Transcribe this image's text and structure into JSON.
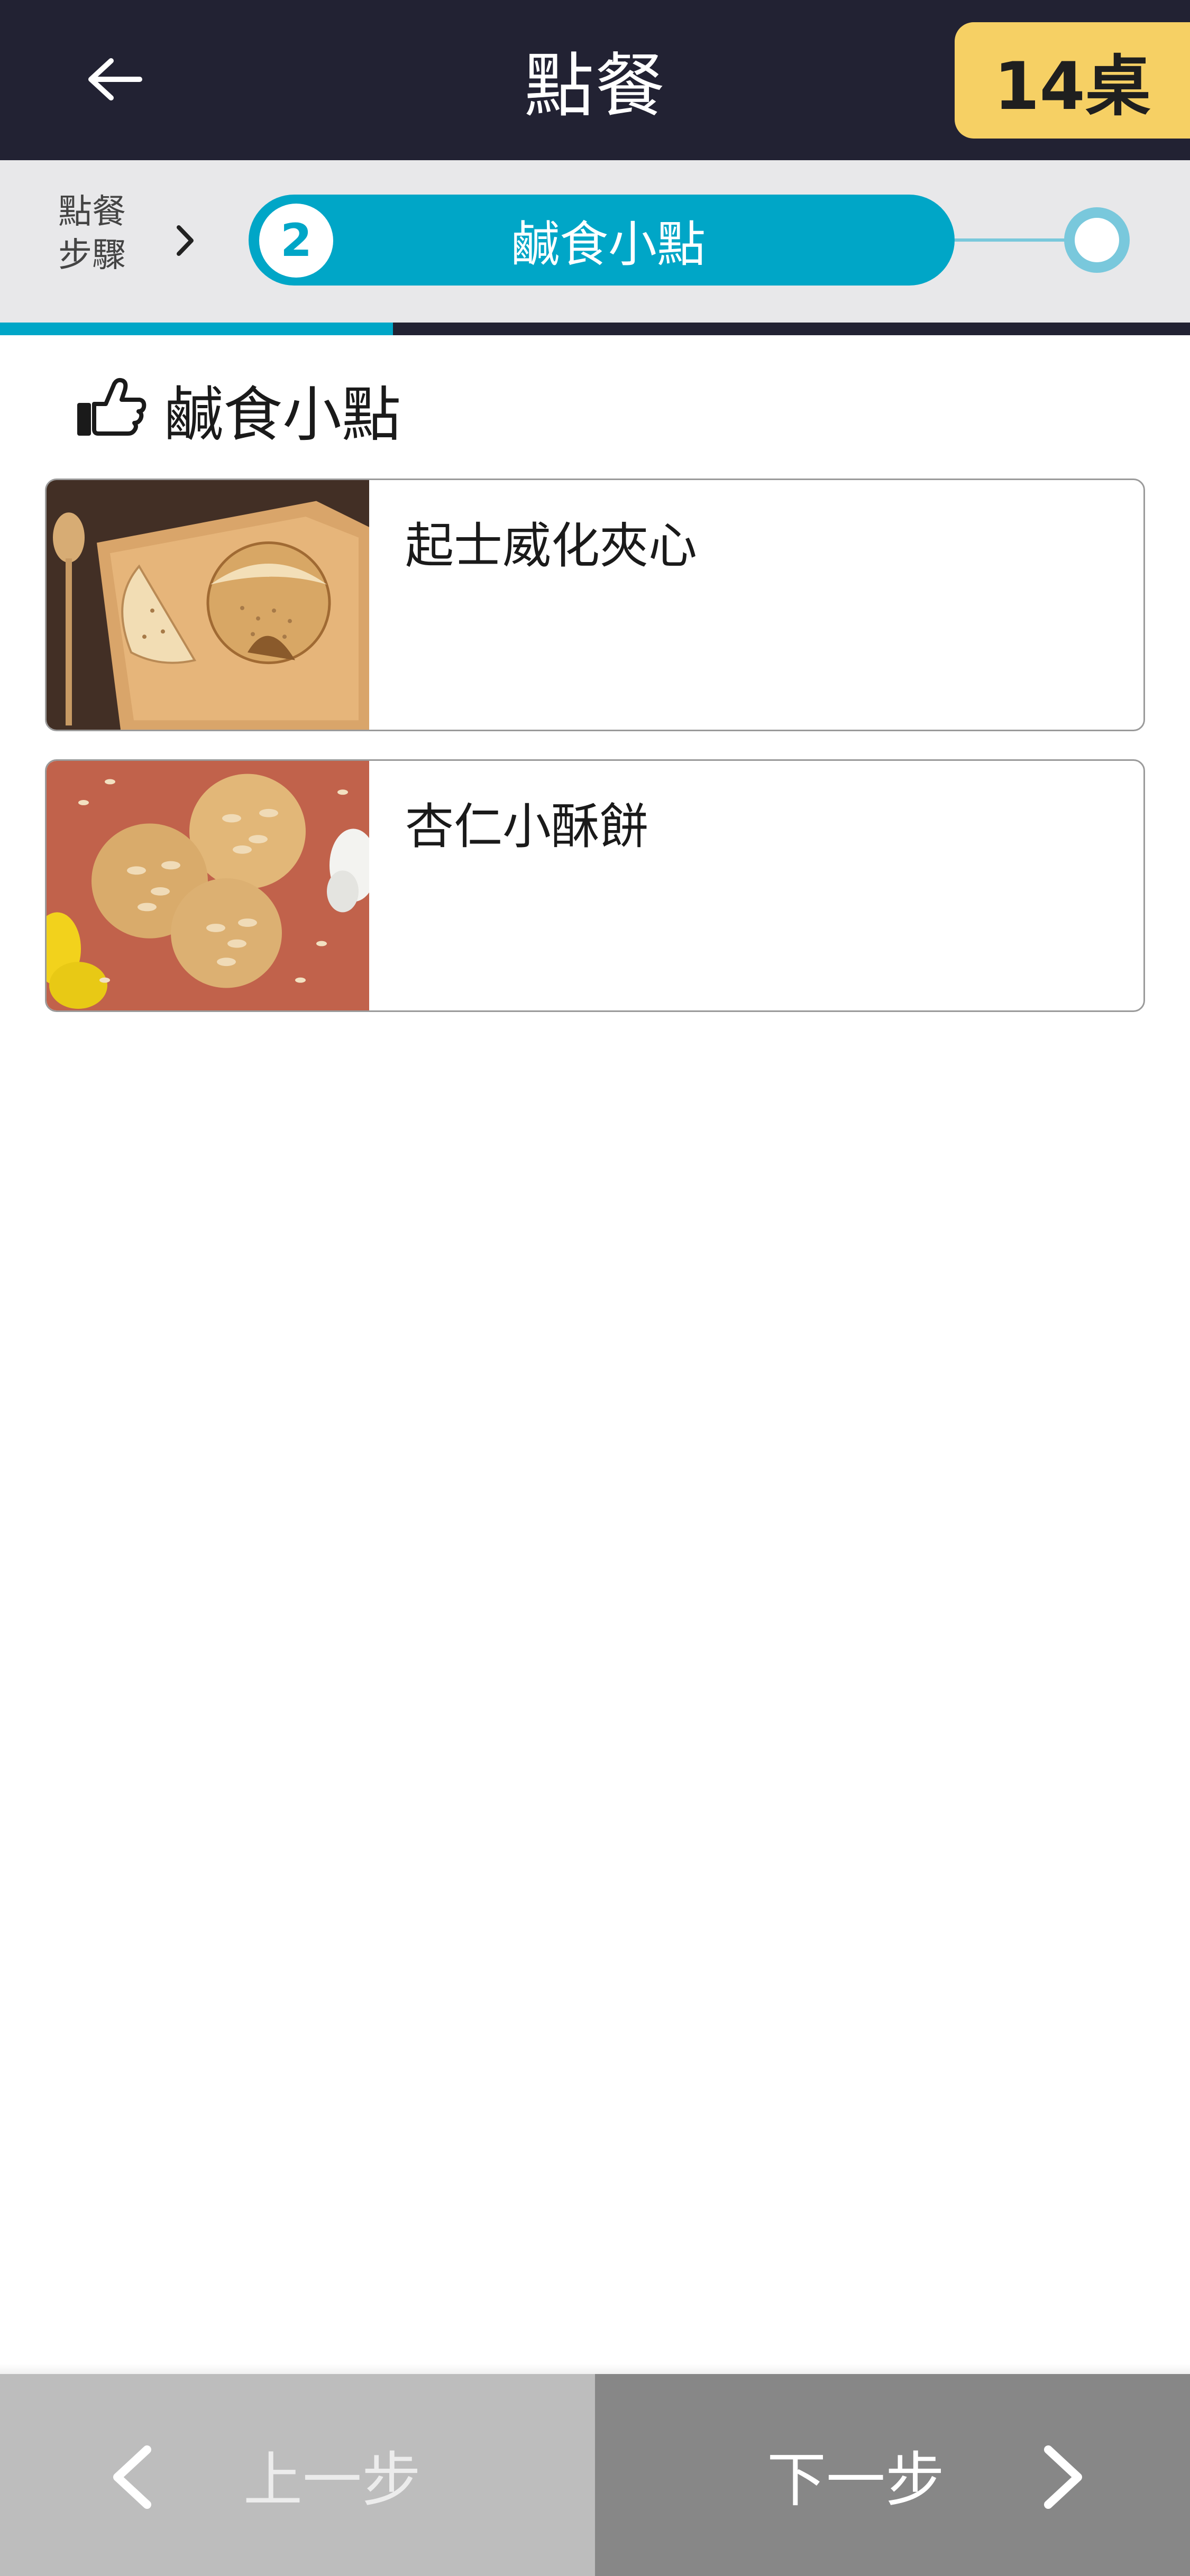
{
  "header": {
    "title": "點餐",
    "table_badge": "14桌",
    "back_icon": "arrow-left-icon"
  },
  "steps": {
    "label": "點餐步驟",
    "label_line1": "點餐",
    "label_line2": "步驟",
    "current_number": "2",
    "current_name": "鹹食小點",
    "progress_fraction": 0.33
  },
  "section": {
    "icon": "thumbs-up-pointing-icon",
    "title": "鹹食小點"
  },
  "items": [
    {
      "name": "起士威化夾心",
      "image": "cheese-wafer-photo"
    },
    {
      "name": "杏仁小酥餅",
      "image": "almond-cookie-photo"
    }
  ],
  "nav": {
    "prev_label": "上一步",
    "next_label": "下一步"
  },
  "colors": {
    "header_bg": "#222233",
    "accent": "#00a6c7",
    "badge": "#f6d064",
    "prev_bg": "#bdbdbd",
    "next_bg": "#878787"
  }
}
